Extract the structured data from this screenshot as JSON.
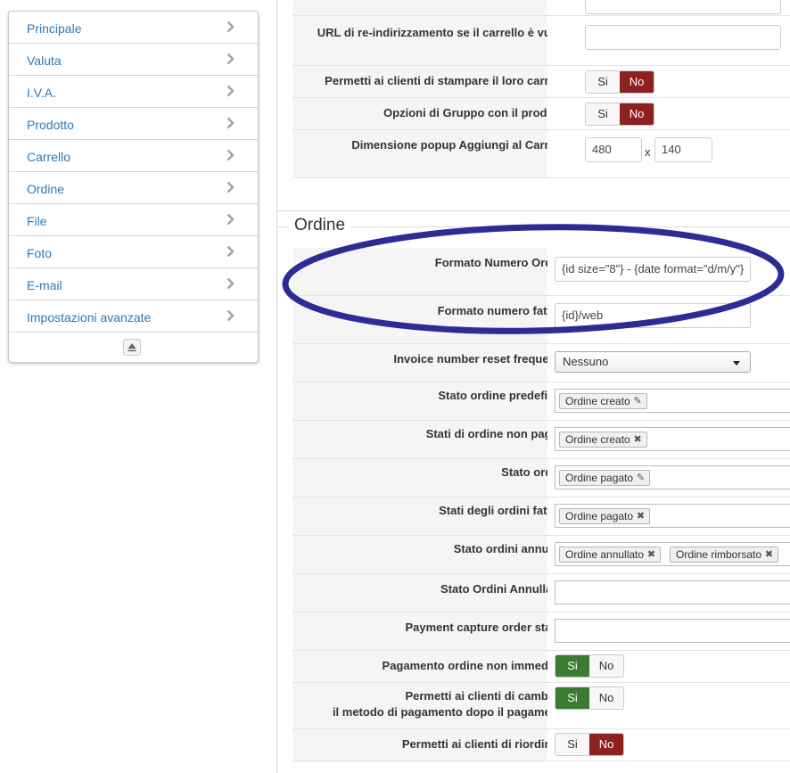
{
  "sidebar": {
    "items": [
      {
        "label": "Principale"
      },
      {
        "label": "Valuta"
      },
      {
        "label": "I.V.A."
      },
      {
        "label": "Prodotto"
      },
      {
        "label": "Carrello"
      },
      {
        "label": "Ordine"
      },
      {
        "label": "File"
      },
      {
        "label": "Foto"
      },
      {
        "label": "E-mail"
      },
      {
        "label": "Impostazioni avanzate"
      }
    ]
  },
  "cart": {
    "redirect_label": "URL di re-indirizzamento se il carrello è vuoto",
    "redirect_value": "",
    "print_label": "Permetti ai clienti di stampare il loro carrello",
    "group_label": "Opzioni di Gruppo con il prodotto",
    "popup_label": "Dimensione popup Aggiungi al Carrello",
    "popup_width": "480",
    "popup_sep": "x",
    "popup_height": "140"
  },
  "toggle": {
    "yes": "Si",
    "no": "No"
  },
  "order": {
    "legend": "Ordine",
    "number_format_label": "Formato Numero Ordine",
    "number_format_value": "{id size=\"8\"} - {date format=\"d/m/y\"}",
    "invoice_format_label": "Formato numero fattura",
    "invoice_format_value": "{id}/web",
    "reset_label": "Invoice number reset frequency",
    "reset_value": "Nessuno",
    "default_status_label": "Stato ordine predefinito",
    "default_status_tag": "Ordine creato",
    "unpaid_label": "Stati di ordine non pagato",
    "unpaid_tag": "Ordine creato",
    "status_label": "Stato ordine",
    "status_tag": "Ordine pagato",
    "invoice_status_label": "Stati degli ordini fatture",
    "invoice_status_tag": "Ordine pagato",
    "cancelled_label": "Stato ordini annullati",
    "cancelled_tags": [
      "Ordine annullato",
      "Ordine rimborsato"
    ],
    "cancellable_label": "Stato Ordini Annullabili",
    "capture_label": "Payment capture order status",
    "not_immediate_label": "Pagamento ordine non immediato",
    "change_method_label_1": "Permetti ai clienti di cambiare",
    "change_method_label_2": "il metodo di pagamento dopo il pagamento",
    "reorder_label": "Permetti ai clienti di riordinare"
  },
  "colors": {
    "link": "#2a7ab8",
    "no_active": "#8f2020",
    "yes_active": "#3a7a32",
    "annotation": "#1a1a8c"
  }
}
